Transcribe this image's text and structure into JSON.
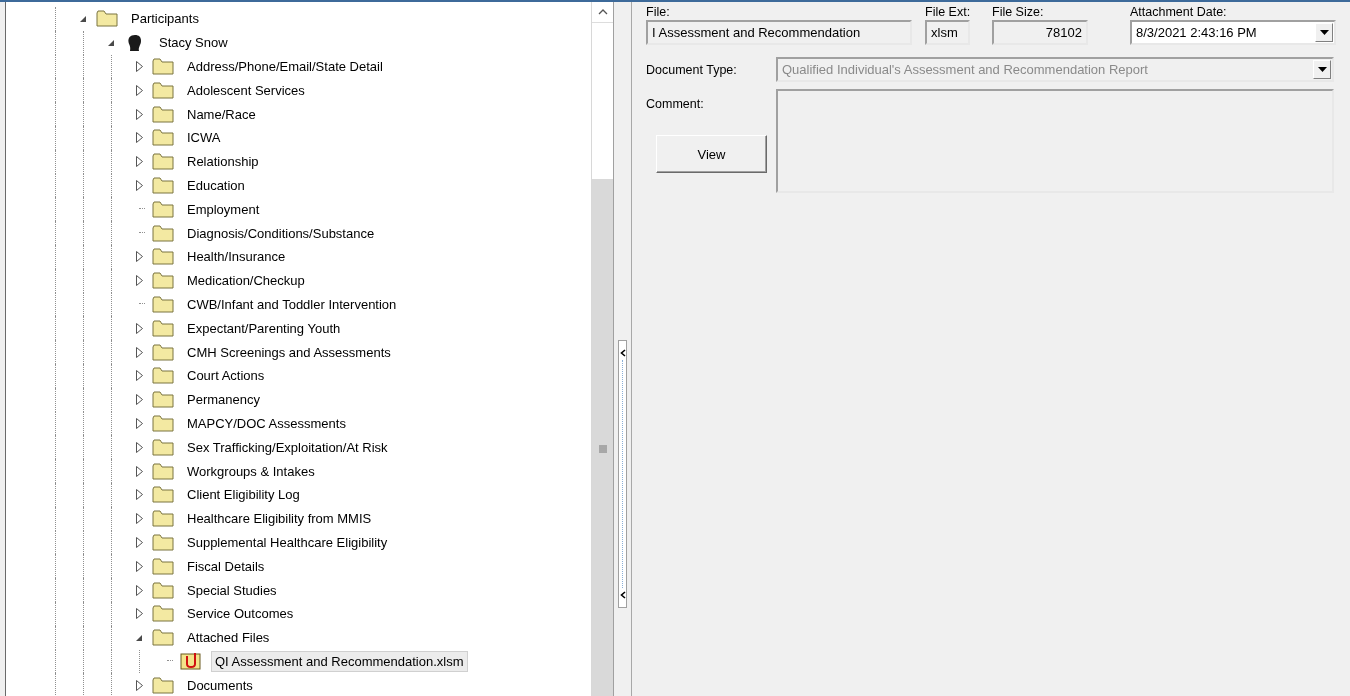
{
  "tree": [
    {
      "label": "Participants",
      "kind": "folder",
      "expanded": true,
      "selected": false,
      "children": [
        {
          "label": "Stacy Snow",
          "kind": "person",
          "expanded": true,
          "selected": false,
          "children": [
            {
              "label": "Address/Phone/Email/State Detail",
              "kind": "folder",
              "expanded": false,
              "selected": false
            },
            {
              "label": "Adolescent Services",
              "kind": "folder",
              "expanded": false,
              "selected": false
            },
            {
              "label": "Name/Race",
              "kind": "folder",
              "expanded": false,
              "selected": false
            },
            {
              "label": "ICWA",
              "kind": "folder",
              "expanded": false,
              "selected": false
            },
            {
              "label": "Relationship",
              "kind": "folder",
              "expanded": false,
              "selected": false
            },
            {
              "label": "Education",
              "kind": "folder",
              "expanded": false,
              "selected": false
            },
            {
              "label": "Employment",
              "kind": "empty-folder",
              "selected": false
            },
            {
              "label": "Diagnosis/Conditions/Substance",
              "kind": "empty-folder",
              "selected": false
            },
            {
              "label": "Health/Insurance",
              "kind": "folder",
              "expanded": false,
              "selected": false
            },
            {
              "label": "Medication/Checkup",
              "kind": "folder",
              "expanded": false,
              "selected": false
            },
            {
              "label": "CWB/Infant and Toddler Intervention",
              "kind": "empty-folder",
              "selected": false
            },
            {
              "label": "Expectant/Parenting Youth",
              "kind": "folder",
              "expanded": false,
              "selected": false
            },
            {
              "label": "CMH Screenings and Assessments",
              "kind": "folder",
              "expanded": false,
              "selected": false
            },
            {
              "label": "Court Actions",
              "kind": "folder",
              "expanded": false,
              "selected": false
            },
            {
              "label": "Permanency",
              "kind": "folder",
              "expanded": false,
              "selected": false
            },
            {
              "label": "MAPCY/DOC Assessments",
              "kind": "folder",
              "expanded": false,
              "selected": false
            },
            {
              "label": "Sex Trafficking/Exploitation/At Risk",
              "kind": "folder",
              "expanded": false,
              "selected": false
            },
            {
              "label": "Workgroups & Intakes",
              "kind": "folder",
              "expanded": false,
              "selected": false
            },
            {
              "label": "Client Eligibility Log",
              "kind": "folder",
              "expanded": false,
              "selected": false
            },
            {
              "label": "Healthcare Eligibility from MMIS",
              "kind": "folder",
              "expanded": false,
              "selected": false
            },
            {
              "label": "Supplemental Healthcare Eligibility",
              "kind": "folder",
              "expanded": false,
              "selected": false
            },
            {
              "label": "Fiscal Details",
              "kind": "folder",
              "expanded": false,
              "selected": false
            },
            {
              "label": "Special Studies",
              "kind": "folder",
              "expanded": false,
              "selected": false
            },
            {
              "label": "Service Outcomes",
              "kind": "folder",
              "expanded": false,
              "selected": false
            },
            {
              "label": "Attached Files",
              "kind": "folder",
              "expanded": true,
              "selected": false,
              "children": [
                {
                  "label": "QI Assessment and Recommendation.xlsm",
                  "kind": "file",
                  "selected": true
                }
              ]
            },
            {
              "label": "Documents",
              "kind": "folder",
              "expanded": false,
              "selected": false
            }
          ]
        }
      ]
    }
  ],
  "details": {
    "file_label": "File:",
    "file_value": "I Assessment and Recommendation",
    "ext_label": "File Ext:",
    "ext_value": "xlsm",
    "size_label": "File Size:",
    "size_value": "78102",
    "date_label": "Attachment Date:",
    "date_value": "8/3/2021 2:43:16 PM",
    "doctype_label": "Document Type:",
    "doctype_value": "Qualified Individual's Assessment and Recommendation Report",
    "comment_label": "Comment:",
    "view_button": "View"
  }
}
